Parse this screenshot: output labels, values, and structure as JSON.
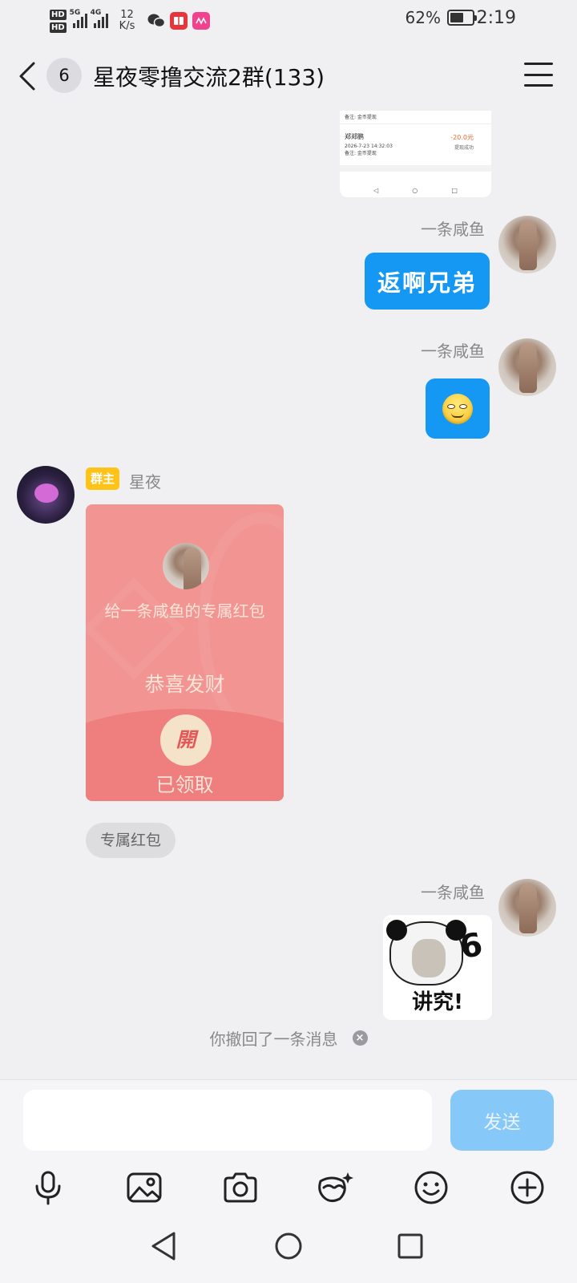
{
  "status_bar": {
    "hd1": "HD",
    "hd2": "HD",
    "sig1_tag": "5G",
    "sig2_tag": "4G",
    "speed_value": "12",
    "speed_unit": "K/s",
    "battery_pct": "62%",
    "battery_level": 0.62,
    "time": "2:19",
    "icons": [
      "wechat-icon",
      "book-icon",
      "app-icon"
    ]
  },
  "header": {
    "unread_count": "6",
    "title": "星夜零撸交流2群(133)"
  },
  "screenshot_card": {
    "row1_note": "备注: 金币提现",
    "row2_name": "郑郑鹏",
    "row2_amount": "-20.0元",
    "row2_time": "2026-7-23 14:32:03",
    "row2_status": "提现成功",
    "row2_note": "备注: 金币提现"
  },
  "messages": {
    "m1_sender": "一条咸鱼",
    "m1_text": "返啊兄弟",
    "m2_sender": "一条咸鱼",
    "owner_badge": "群主",
    "owner_name": "星夜",
    "red_packet": {
      "message": "给一条咸鱼的专属红包",
      "wish": "恭喜发财",
      "open_label": "開",
      "status": "已领取",
      "tag": "专属红包"
    },
    "m4_sender": "一条咸鱼",
    "sticker_text": "讲究!",
    "recall_text": "你撤回了一条消息"
  },
  "input": {
    "placeholder": "",
    "send_label": "发送"
  },
  "colors": {
    "accent": "#1598f3",
    "send_disabled": "#86c8f8",
    "red_packet": "#f29492",
    "owner_badge": "#ffc318"
  }
}
